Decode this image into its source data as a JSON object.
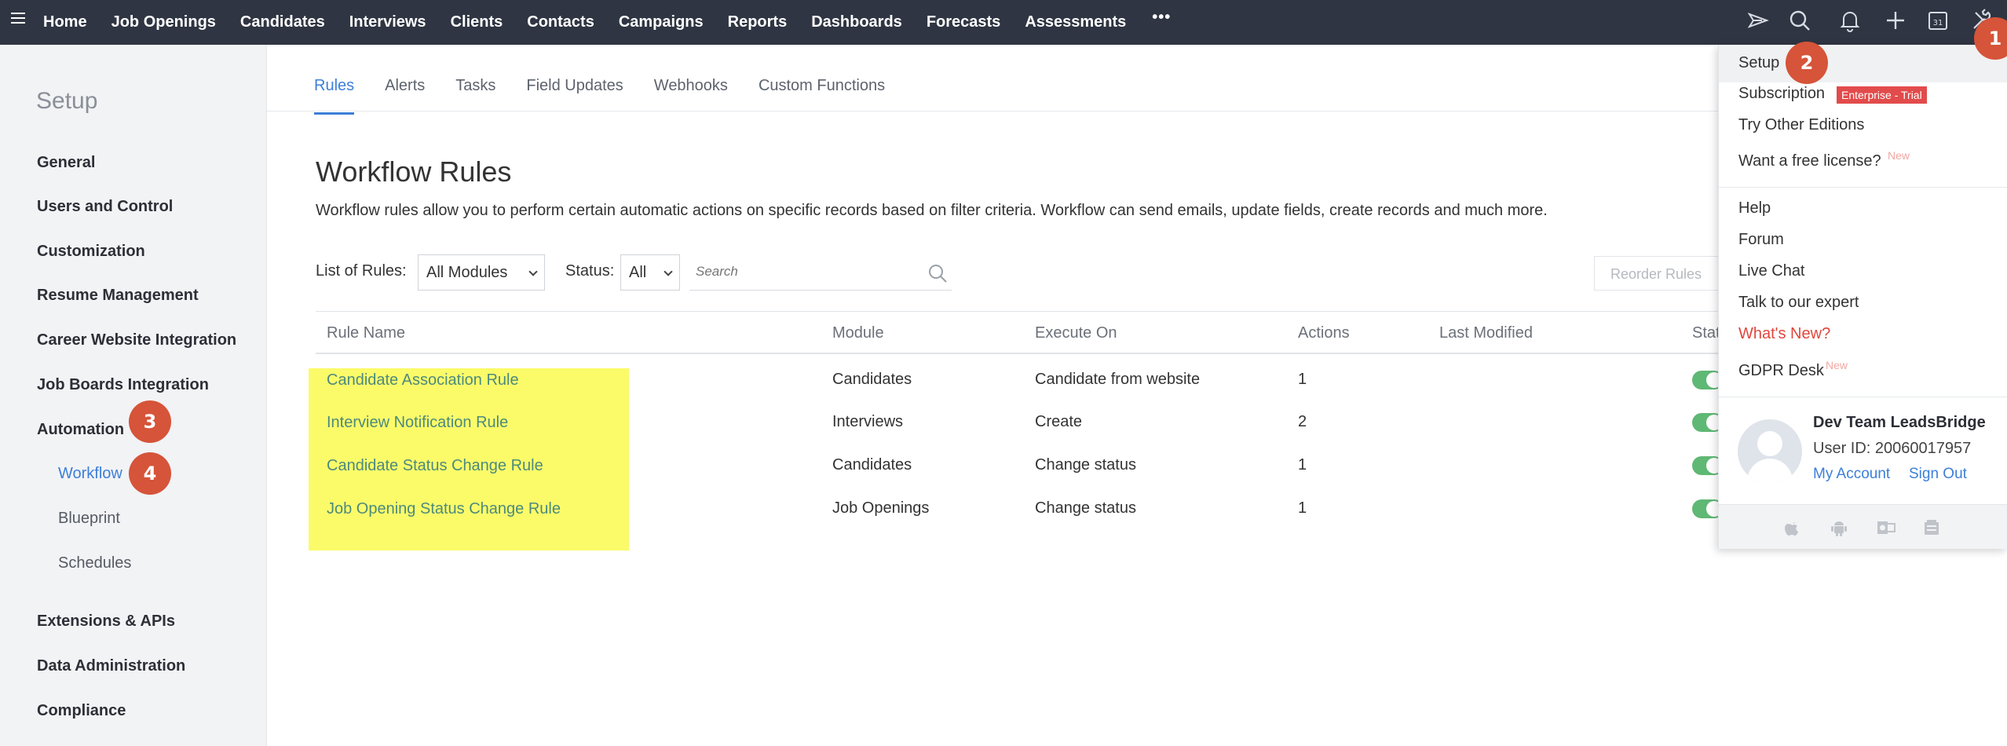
{
  "topnav": {
    "items": [
      "Home",
      "Job Openings",
      "Candidates",
      "Interviews",
      "Clients",
      "Contacts",
      "Campaigns",
      "Reports",
      "Dashboards",
      "Forecasts",
      "Assessments"
    ],
    "more": "•••",
    "icons": [
      "feeds-icon",
      "search-icon",
      "bell-icon",
      "plus-icon",
      "calendar-icon",
      "setup-tools-icon"
    ],
    "calendar_day": "31"
  },
  "sidebar": {
    "title": "Setup",
    "sections": [
      "General",
      "Users and Control",
      "Customization",
      "Resume Management",
      "Career Website Integration",
      "Job Boards Integration",
      "Automation",
      "Extensions & APIs",
      "Data Administration",
      "Compliance"
    ],
    "automation_items": [
      "Workflow",
      "Blueprint",
      "Schedules"
    ]
  },
  "badges": [
    "1",
    "2",
    "3",
    "4"
  ],
  "tabs": [
    "Rules",
    "Alerts",
    "Tasks",
    "Field Updates",
    "Webhooks",
    "Custom Functions"
  ],
  "main": {
    "title": "Workflow Rules",
    "description": "Workflow rules allow you to perform certain automatic actions on specific records based on filter criteria. Workflow can send emails, update fields, create records and much more.",
    "list_label": "List of Rules:",
    "module_value": "All Modules",
    "status_label": "Status:",
    "status_value": "All",
    "search_placeholder": "Search",
    "reorder_label": "Reorder Rules"
  },
  "table": {
    "headers": [
      "Rule Name",
      "Module",
      "Execute On",
      "Actions",
      "Last Modified",
      "Status"
    ],
    "rows": [
      {
        "name": "Candidate Association Rule",
        "module": "Candidates",
        "execute": "Candidate from website",
        "actions": "1",
        "modified": ""
      },
      {
        "name": "Interview Notification Rule",
        "module": "Interviews",
        "execute": "Create",
        "actions": "2",
        "modified": ""
      },
      {
        "name": "Candidate Status Change Rule",
        "module": "Candidates",
        "execute": "Change status",
        "actions": "1",
        "modified": ""
      },
      {
        "name": "Job Opening Status Change Rule",
        "module": "Job Openings",
        "execute": "Change status",
        "actions": "1",
        "modified": ""
      }
    ],
    "highlight_color": "#fbfb6a",
    "toggle_color": "#5fb874"
  },
  "panel": {
    "setup": "Setup",
    "subscription": "Subscription",
    "subscription_tag": "Enterprise - Trial",
    "try_editions": "Try Other Editions",
    "free_license": "Want a free license?",
    "new_tag": "New",
    "help": "Help",
    "forum": "Forum",
    "live_chat": "Live Chat",
    "talk_expert": "Talk to our expert",
    "whats_new": "What's New?",
    "gdpr": "GDPR Desk",
    "user_name": "Dev Team LeadsBridge",
    "user_id": "User ID: 20060017957",
    "my_account": "My Account",
    "sign_out": "Sign Out",
    "os_icons": [
      "apple-icon",
      "android-icon",
      "outlook-icon",
      "office-icon"
    ]
  },
  "colors": {
    "topbar": "#2f3542",
    "accent": "#3d7fd8",
    "badge": "#d65439",
    "tag": "#e24b4b"
  }
}
